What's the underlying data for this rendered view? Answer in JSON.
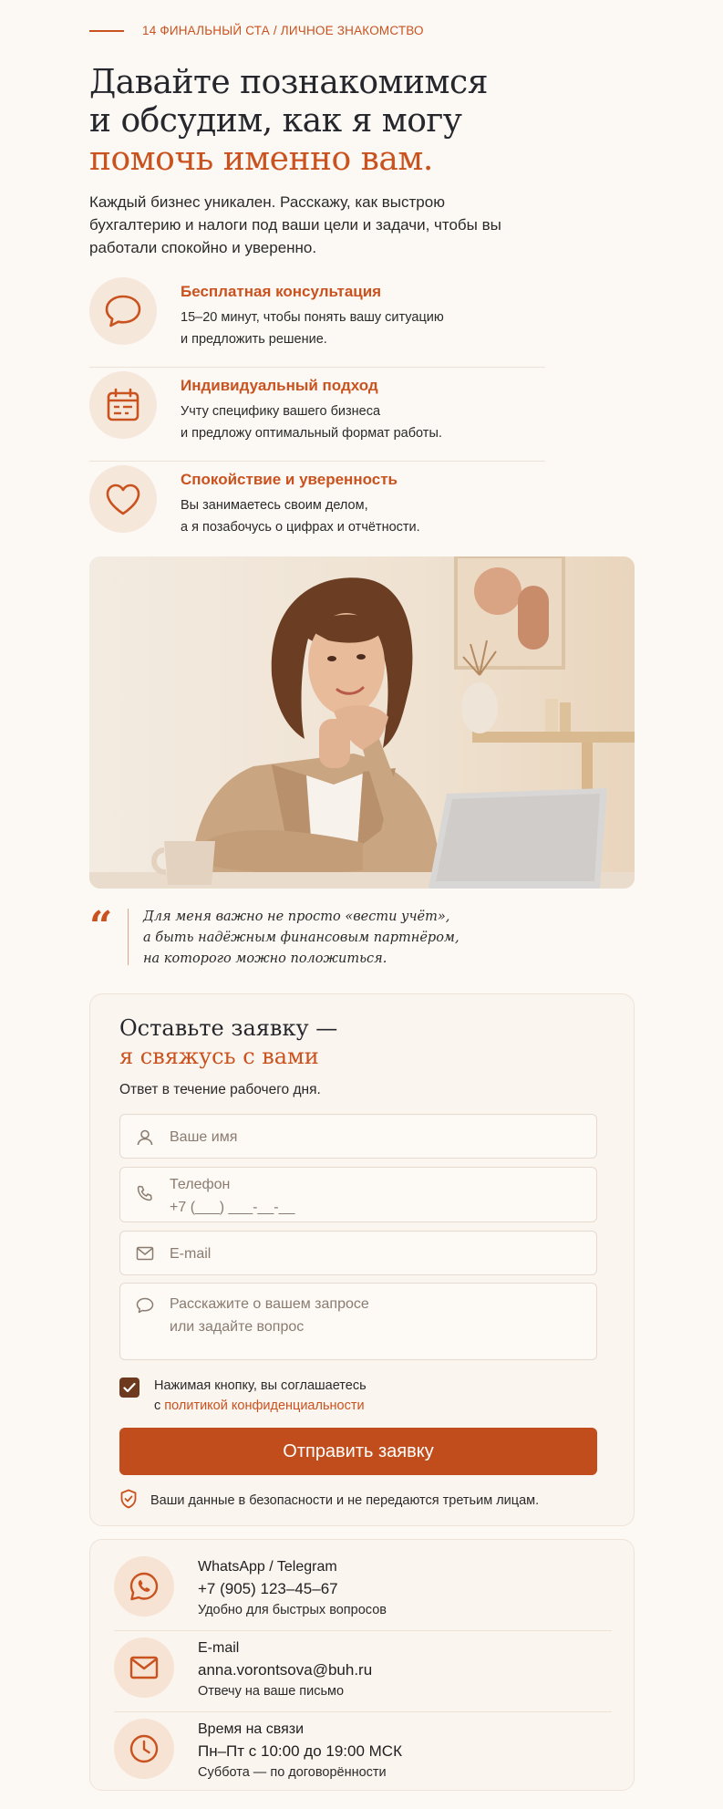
{
  "eyebrow": "14 ФИНАЛЬНЫЙ СТА / ЛИЧНОЕ ЗНАКОМСТВО",
  "hero": {
    "title_line1": "Давайте познакомимся",
    "title_line2": "и обсудим, как я могу",
    "title_accent": "помочь именно вам.",
    "lead": "Каждый бизнес уникален. Расскажу, как выстрою бухгалтерию и налоги под ваши цели и задачи, чтобы вы работали спокойно и уверенно."
  },
  "features": [
    {
      "icon": "chat-bubble-icon",
      "title": "Бесплатная консультация",
      "line1": "15–20 минут, чтобы понять вашу ситуацию",
      "line2": "и предложить решение."
    },
    {
      "icon": "calendar-icon",
      "title": "Индивидуальный подход",
      "line1": "Учту специфику вашего бизнеса",
      "line2": "и предложу оптимальный формат работы."
    },
    {
      "icon": "heart-icon",
      "title": "Спокойствие и уверенность",
      "line1": "Вы занимаетесь своим делом,",
      "line2": "а я позабочусь о цифрах и отчётности."
    }
  ],
  "quote": {
    "mark": "“",
    "line1": "Для меня важно не просто «вести учёт»,",
    "line2": "а быть надёжным финансовым партнёром,",
    "line3": "на которого можно положиться."
  },
  "form": {
    "title": "Оставьте заявку —",
    "title_accent": "я свяжусь с вами",
    "subtitle": "Ответ в течение рабочего дня.",
    "name_placeholder": "Ваше имя",
    "phone_label": "Телефон",
    "phone_mask": "+7 (___) ___-__-__",
    "email_placeholder": "E-mail",
    "message_line1": "Расскажите о вашем запросе",
    "message_line2": "или задайте вопрос",
    "consent_line1": "Нажимая кнопку, вы соглашаетесь",
    "consent_prefix": "с ",
    "consent_link": "политикой конфиденциальности",
    "consent_checked": true,
    "submit_label": "Отправить заявку",
    "security_note": "Ваши данные в безопасности и не передаются третьим лицам."
  },
  "contacts": [
    {
      "icon": "whatsapp-icon",
      "label": "WhatsApp / Telegram",
      "value": "+7 (905) 123–45–67",
      "note": "Удобно для быстрых вопросов"
    },
    {
      "icon": "mail-icon",
      "label": "E-mail",
      "value": "anna.vorontsova@buh.ru",
      "note": "Отвечу на ваше письмо"
    },
    {
      "icon": "clock-icon",
      "label": "Время на связи",
      "value": "Пн–Пт с 10:00 до 19:00 МСК",
      "note": "Суббота — по договорённости"
    }
  ],
  "colors": {
    "accent": "#c9521f",
    "button": "#c24d1c",
    "background": "#fcf8f4",
    "checkbox": "#6d3a20"
  }
}
